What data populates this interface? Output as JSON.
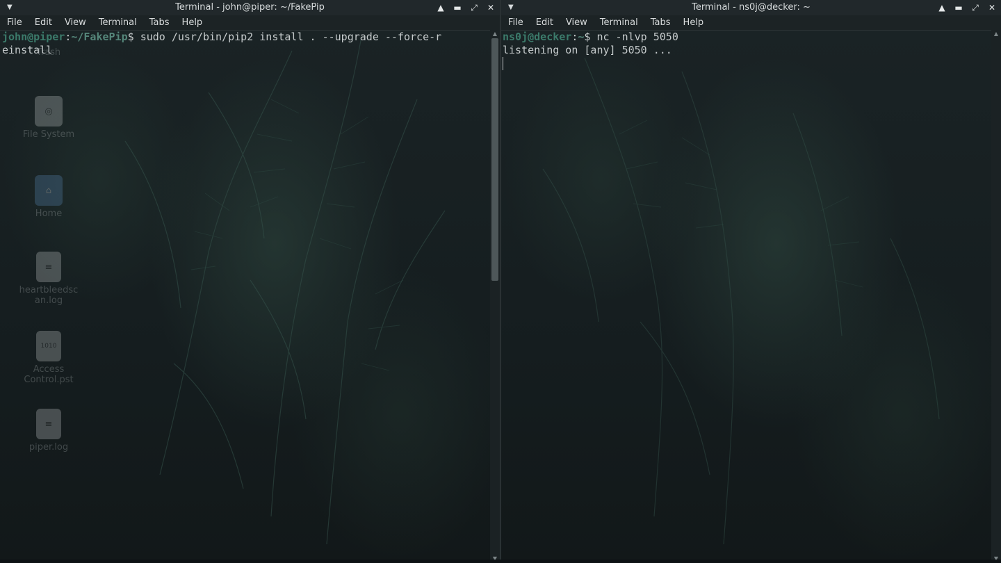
{
  "left_window": {
    "title": "Terminal - john@piper: ~/FakePip",
    "menu": [
      "File",
      "Edit",
      "View",
      "Terminal",
      "Tabs",
      "Help"
    ],
    "prompt_user": "john@piper",
    "prompt_sep": ":",
    "prompt_path": "~/FakePip",
    "prompt_symbol": "$ ",
    "command_line1": "sudo /usr/bin/pip2 install . --upgrade --force-r",
    "command_line2": "einstall",
    "scroll_position": 0.47
  },
  "right_window": {
    "title": "Terminal - ns0j@decker: ~",
    "menu": [
      "File",
      "Edit",
      "View",
      "Terminal",
      "Tabs",
      "Help"
    ],
    "prompt_user": "ns0j@decker",
    "prompt_sep": ":",
    "prompt_path": "~",
    "prompt_symbol": "$ ",
    "command": "nc -nlvp 5050",
    "output": "listening on [any] 5050 ..."
  },
  "desktop_icons": [
    {
      "label": "Trash",
      "icon": "trash-icon"
    },
    {
      "label": "File System",
      "icon": "drive-icon"
    },
    {
      "label": "Home",
      "icon": "home-folder-icon"
    },
    {
      "label": "heartbleedscan.log",
      "label_line1": "heartbleedsc",
      "label_line2": "an.log",
      "icon": "locked-file-icon"
    },
    {
      "label": "Access Control.pst",
      "label_line1": "Access",
      "label_line2": "Control.pst",
      "icon": "binary-file-icon"
    },
    {
      "label": "piper.log",
      "icon": "locked-file-icon"
    }
  ],
  "colors": {
    "prompt": "#3b7a6a",
    "text": "#c6cbcc",
    "titlebar": "#21282b"
  }
}
